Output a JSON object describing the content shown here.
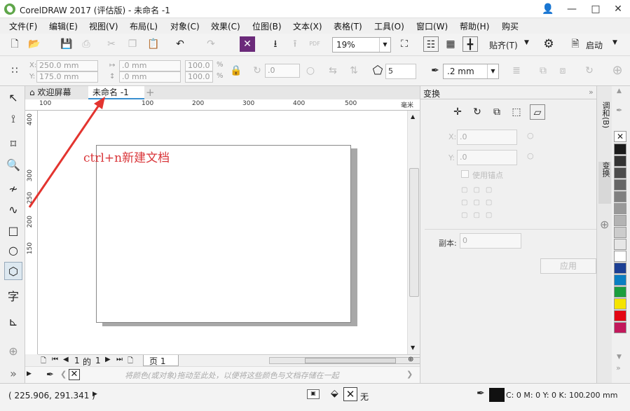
{
  "window": {
    "title": "CorelDRAW 2017 (评估版) - 未命名 -1"
  },
  "menu": [
    "文件(F)",
    "编辑(E)",
    "视图(V)",
    "布局(L)",
    "对象(C)",
    "效果(C)",
    "位图(B)",
    "文本(X)",
    "表格(T)",
    "工具(O)",
    "窗口(W)",
    "帮助(H)",
    "购买"
  ],
  "stdbar": {
    "zoom": "19%",
    "snap_label": "贴齐(T)",
    "launch_label": "启动"
  },
  "propbar": {
    "x": "250.0 mm",
    "y": "175.0 mm",
    "w": ".0 mm",
    "h": ".0 mm",
    "scale_x": "100.0",
    "scale_y": "100.0",
    "pct": "%",
    "angle": ".0",
    "sides": "5",
    "outline": ".2 mm"
  },
  "tabs": [
    {
      "label": "欢迎屏幕"
    },
    {
      "label": "未命名 -1"
    }
  ],
  "ruler": {
    "h_ticks": [
      "100",
      "100",
      "200",
      "300",
      "400",
      "500"
    ],
    "h_unit": "毫米",
    "v_ticks": [
      "400",
      "300",
      "250",
      "200",
      "150"
    ]
  },
  "annotation": "ctrl+n新建文档",
  "pagenav": {
    "current": "1",
    "of": "的",
    "total": "1",
    "page_tab": "页 1"
  },
  "colorbar": {
    "hint": "将颜色(或对象)拖动至此处，以便将这些颜色与文档存储在一起"
  },
  "docker": {
    "title": "变换",
    "x_label": "X:",
    "x_value": ".0",
    "y_label": "Y:",
    "y_value": ".0",
    "anchor_label": "使用锚点",
    "copies_label": "副本:",
    "copies_value": "0",
    "apply_label": "应用"
  },
  "sidetabs": [
    "调和(B)",
    "变换"
  ],
  "palette": {
    "colors": [
      "#1a1a1a",
      "#333333",
      "#4d4d4d",
      "#666666",
      "#808080",
      "#999999",
      "#b3b3b3",
      "#cccccc",
      "#e6e6e6",
      "#ffffff",
      "#1c3f94",
      "#0a7fc2",
      "#1b9e3e",
      "#f5e400",
      "#e30613",
      "#c2185b"
    ]
  },
  "statusbar": {
    "coords": "( 225.906, 291.341 )",
    "fill_none": "无",
    "color_info": "C: 0 M: 0 Y: 0 K: 100",
    "outline_width": ".200 mm"
  }
}
